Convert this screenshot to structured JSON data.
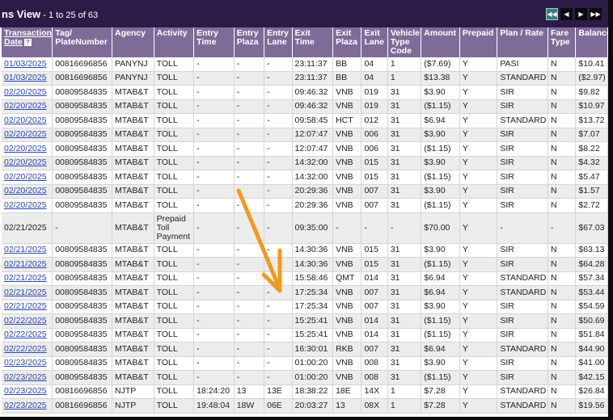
{
  "view": {
    "title_fragment": "ns View",
    "range": " - 1 to 25 of 63"
  },
  "pager": {
    "buttons": [
      "first-icon",
      "prev-icon",
      "next-icon",
      "last-icon"
    ]
  },
  "colors": {
    "header_bg": "#7f6b98",
    "titlebar_bg": "#2d1b47",
    "link": "#2b44b8",
    "arrow": "#f39a1c"
  },
  "columns": [
    "Transaction Date",
    "Tag/ PlateNumber",
    "Agency",
    "Activity",
    "Entry Time",
    "Entry Plaza",
    "Entry Lane",
    "Exit Time",
    "Exit Plaza",
    "Exit Lane",
    "Vehicle Type Code",
    "Amount",
    "Prepaid",
    "Plan / Rate",
    "Fare Type",
    "Balance"
  ],
  "rows": [
    [
      "01/03/2025",
      "00816696856",
      "PANYNJ",
      "TOLL",
      "-",
      "-",
      "-",
      "23:11:37",
      "BB",
      "04",
      "1",
      "($7.69)",
      "Y",
      "PASI",
      "N",
      "$10.41"
    ],
    [
      "01/03/2025",
      "00816696856",
      "PANYNJ",
      "TOLL",
      "-",
      "-",
      "-",
      "23:11:37",
      "BB",
      "04",
      "1",
      "$13.38",
      "Y",
      "STANDARD",
      "N",
      "($2.97)"
    ],
    [
      "02/20/2025",
      "00809584835",
      "MTAB&T",
      "TOLL",
      "-",
      "-",
      "-",
      "09:46:32",
      "VNB",
      "019",
      "31",
      "$3.90",
      "Y",
      "SIR",
      "N",
      "$9.82"
    ],
    [
      "02/20/2025",
      "00809584835",
      "MTAB&T",
      "TOLL",
      "-",
      "-",
      "-",
      "09:46:32",
      "VNB",
      "019",
      "31",
      "($1.15)",
      "Y",
      "SIR",
      "N",
      "$10.97"
    ],
    [
      "02/20/2025",
      "00809584835",
      "MTAB&T",
      "TOLL",
      "-",
      "-",
      "-",
      "09:58:45",
      "HCT",
      "012",
      "31",
      "$6.94",
      "Y",
      "STANDARD",
      "N",
      "$13.72"
    ],
    [
      "02/20/2025",
      "00809584835",
      "MTAB&T",
      "TOLL",
      "-",
      "-",
      "-",
      "12:07:47",
      "VNB",
      "006",
      "31",
      "$3.90",
      "Y",
      "SIR",
      "N",
      "$7.07"
    ],
    [
      "02/20/2025",
      "00809584835",
      "MTAB&T",
      "TOLL",
      "-",
      "-",
      "-",
      "12:07:47",
      "VNB",
      "006",
      "31",
      "($1.15)",
      "Y",
      "SIR",
      "N",
      "$8.22"
    ],
    [
      "02/20/2025",
      "00809584835",
      "MTAB&T",
      "TOLL",
      "-",
      "-",
      "-",
      "14:32:00",
      "VNB",
      "015",
      "31",
      "$3.90",
      "Y",
      "SIR",
      "N",
      "$4.32"
    ],
    [
      "02/20/2025",
      "00809584835",
      "MTAB&T",
      "TOLL",
      "-",
      "-",
      "-",
      "14:32:00",
      "VNB",
      "015",
      "31",
      "($1.15)",
      "Y",
      "SIR",
      "N",
      "$5.47"
    ],
    [
      "02/20/2025",
      "00809584835",
      "MTAB&T",
      "TOLL",
      "-",
      "-",
      "-",
      "20:29:36",
      "VNB",
      "007",
      "31",
      "$3.90",
      "Y",
      "SIR",
      "N",
      "$1.57"
    ],
    [
      "02/20/2025",
      "00809584835",
      "MTAB&T",
      "TOLL",
      "-",
      "-",
      "-",
      "20:29:36",
      "VNB",
      "007",
      "31",
      "($1.15)",
      "Y",
      "SIR",
      "N",
      "$2.72"
    ],
    [
      "02/21/2025",
      "-",
      "MTAB&T",
      "Prepaid Toll Payment",
      "-",
      "-",
      "-",
      "09:35:00",
      "-",
      "-",
      "-",
      "$70.00",
      "Y",
      "-",
      "-",
      "$67.03"
    ],
    [
      "02/21/2025",
      "00809584835",
      "MTAB&T",
      "TOLL",
      "-",
      "-",
      "-",
      "14:30:36",
      "VNB",
      "015",
      "31",
      "$3.90",
      "Y",
      "SIR",
      "N",
      "$63.13"
    ],
    [
      "02/21/2025",
      "00809584835",
      "MTAB&T",
      "TOLL",
      "-",
      "-",
      "-",
      "14:30:36",
      "VNB",
      "015",
      "31",
      "($1.15)",
      "Y",
      "SIR",
      "N",
      "$64.28"
    ],
    [
      "02/21/2025",
      "00809584835",
      "MTAB&T",
      "TOLL",
      "-",
      "-",
      "-",
      "15:58:46",
      "QMT",
      "014",
      "31",
      "$6.94",
      "Y",
      "STANDARD",
      "N",
      "$57.34"
    ],
    [
      "02/21/2025",
      "00809584835",
      "MTAB&T",
      "TOLL",
      "-",
      "-",
      "-",
      "17:25:34",
      "VNB",
      "007",
      "31",
      "$6.94",
      "Y",
      "STANDARD",
      "N",
      "$53.44"
    ],
    [
      "02/21/2025",
      "00809584835",
      "MTAB&T",
      "TOLL",
      "-",
      "-",
      "-",
      "17:25:34",
      "VNB",
      "007",
      "31",
      "$3.90",
      "Y",
      "SIR",
      "N",
      "$54.59"
    ],
    [
      "02/22/2025",
      "00809584835",
      "MTAB&T",
      "TOLL",
      "-",
      "-",
      "-",
      "15:25:41",
      "VNB",
      "014",
      "31",
      "($1.15)",
      "Y",
      "SIR",
      "N",
      "$50.69"
    ],
    [
      "02/22/2025",
      "00809584835",
      "MTAB&T",
      "TOLL",
      "-",
      "-",
      "-",
      "15:25:41",
      "VNB",
      "014",
      "31",
      "($1.15)",
      "Y",
      "SIR",
      "N",
      "$51.84"
    ],
    [
      "02/22/2025",
      "00809584835",
      "MTAB&T",
      "TOLL",
      "-",
      "-",
      "-",
      "16:30:01",
      "RKB",
      "007",
      "31",
      "$6.94",
      "Y",
      "STANDARD",
      "N",
      "$44.90"
    ],
    [
      "02/23/2025",
      "00809584835",
      "MTAB&T",
      "TOLL",
      "-",
      "-",
      "-",
      "01:00:20",
      "VNB",
      "008",
      "31",
      "$3.90",
      "Y",
      "SIR",
      "N",
      "$41.00"
    ],
    [
      "02/23/2025",
      "00809584835",
      "MTAB&T",
      "TOLL",
      "-",
      "-",
      "-",
      "01:00:20",
      "VNB",
      "008",
      "31",
      "($1.15)",
      "Y",
      "SIR",
      "N",
      "$42.15"
    ],
    [
      "02/23/2025",
      "00816696856",
      "NJTP",
      "TOLL",
      "18:24:20",
      "13",
      "13E",
      "18:38:22",
      "18E",
      "14X",
      "1",
      "$7.28",
      "Y",
      "STANDARD",
      "N",
      "$26.84"
    ],
    [
      "02/23/2025",
      "00816696856",
      "NJTP",
      "TOLL",
      "19:48:04",
      "18W",
      "06E",
      "20:03:27",
      "13",
      "08X",
      "1",
      "$7.28",
      "Y",
      "STANDARD",
      "N",
      "$19.56"
    ]
  ]
}
